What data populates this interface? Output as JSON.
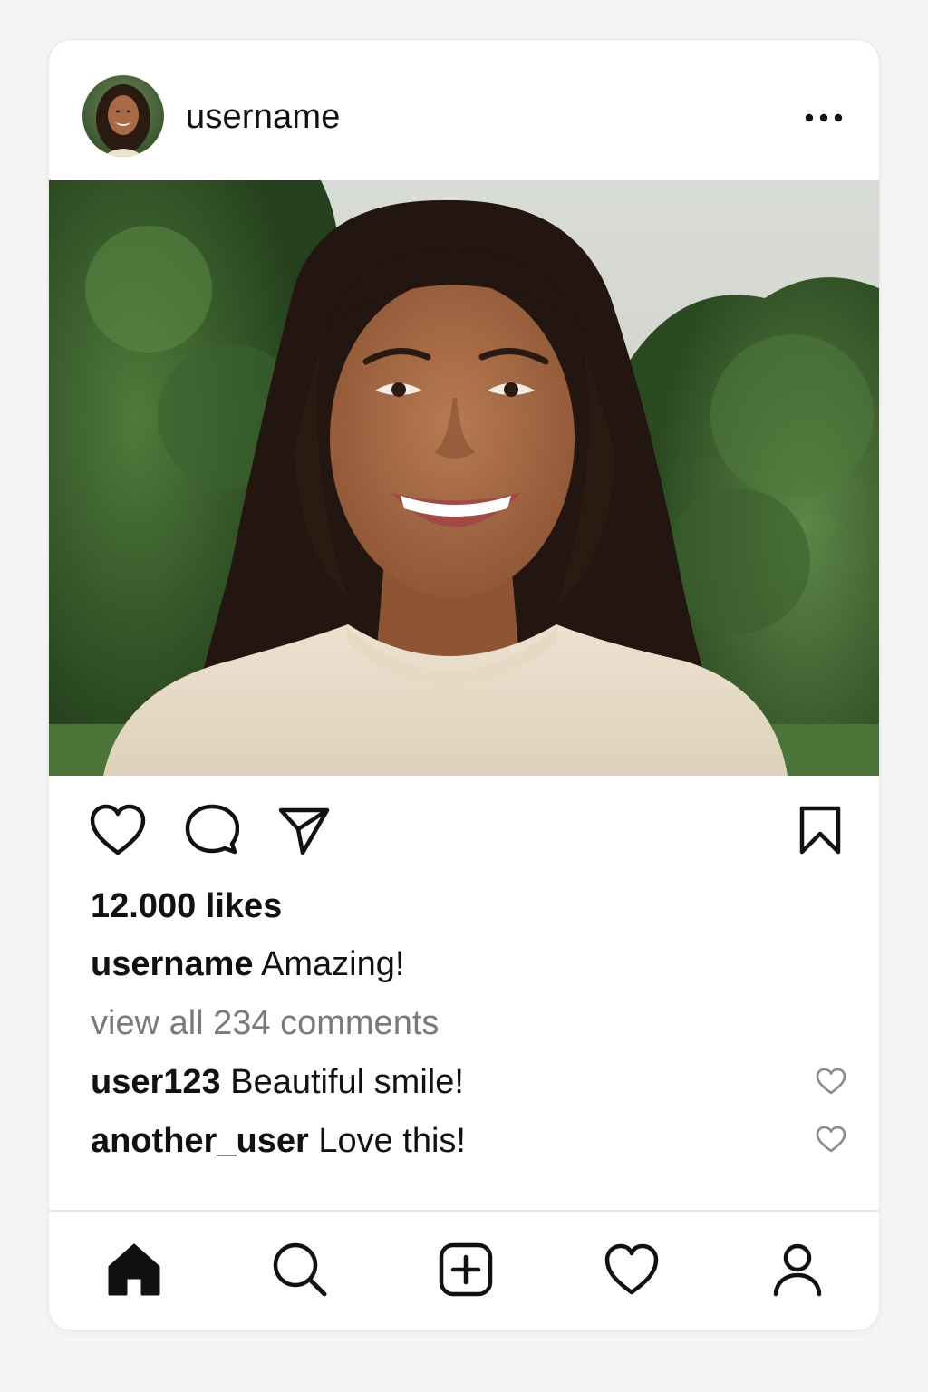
{
  "post": {
    "username": "username",
    "likes_text": "12.000 likes",
    "caption": {
      "username": "username",
      "text": "Amazing!"
    },
    "view_comments": "view all 234 comments",
    "comments": [
      {
        "username": "user123",
        "text": "Beautiful smile!"
      },
      {
        "username": "another_user",
        "text": "Love this!"
      }
    ]
  },
  "icons": {
    "more": "more-horizontal-icon",
    "like": "heart-icon",
    "comment": "comment-icon",
    "share": "send-icon",
    "save": "bookmark-icon",
    "nav": [
      "home-icon",
      "search-icon",
      "add-post-icon",
      "activity-heart-icon",
      "profile-icon"
    ]
  },
  "colors": {
    "text": "#111111",
    "muted": "#7a7a7a",
    "border": "#e6e6e6",
    "background": "#f5f5f5"
  }
}
